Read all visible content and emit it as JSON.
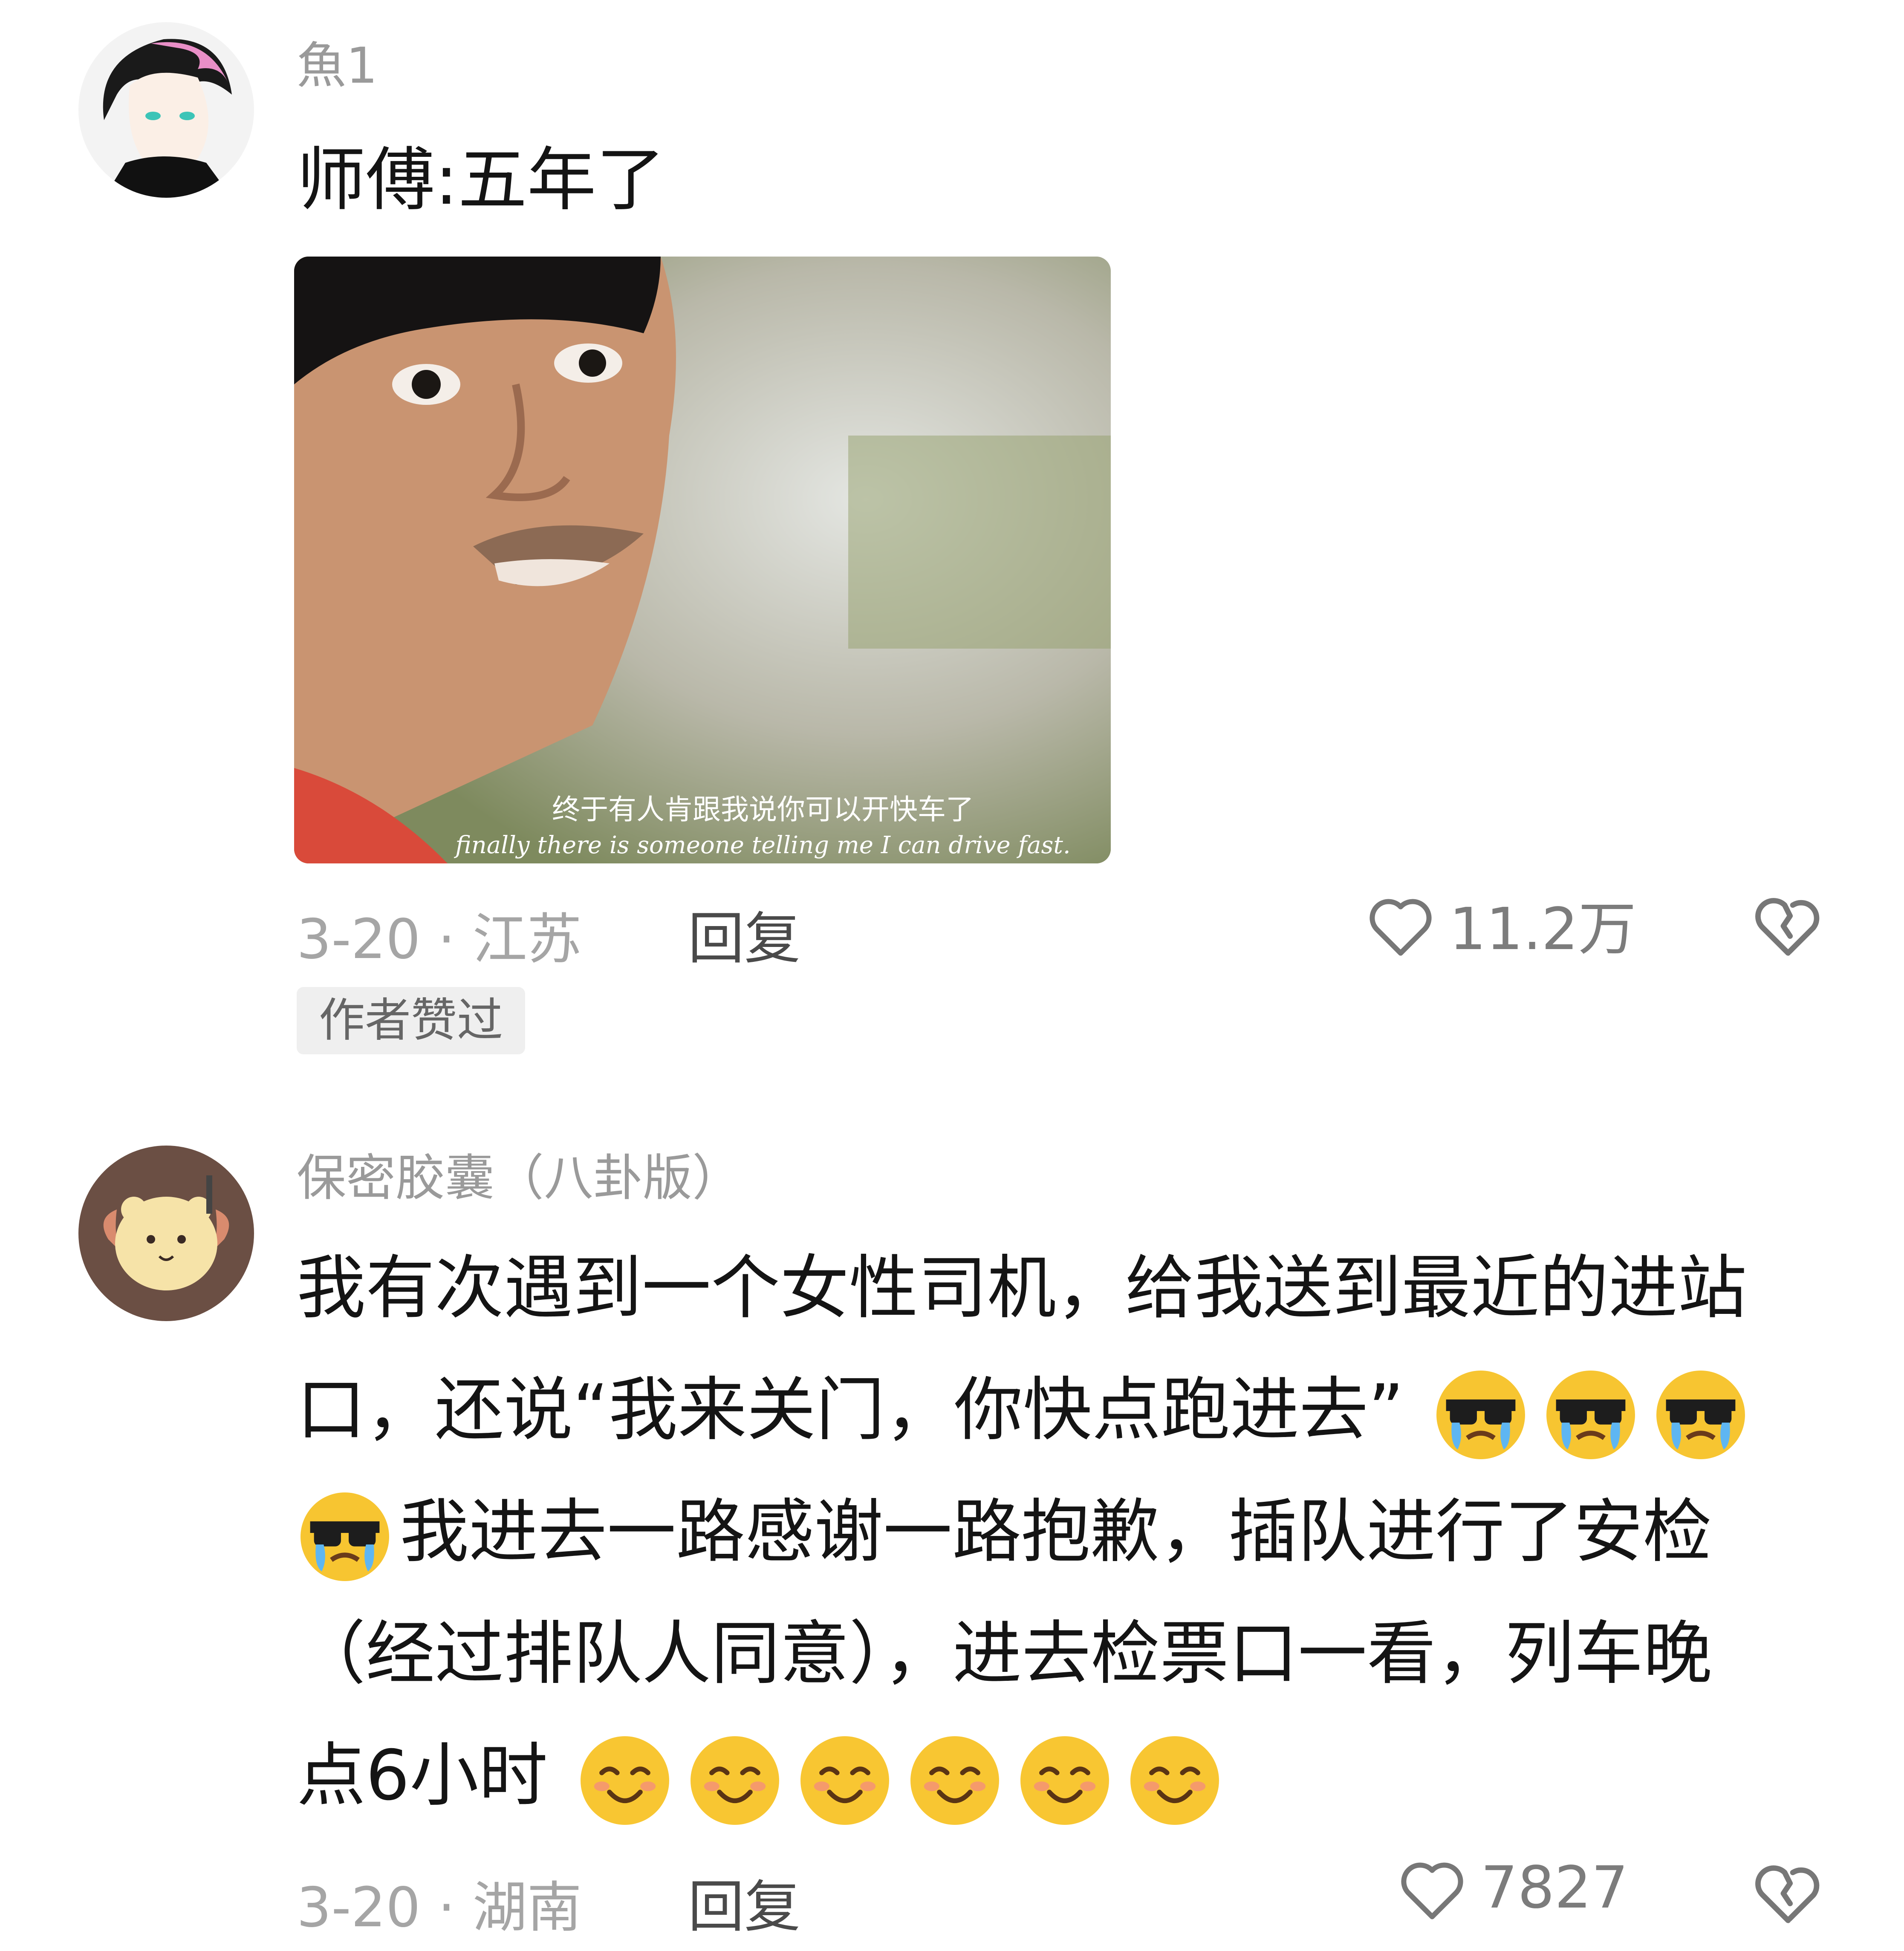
{
  "comments": [
    {
      "username": "魚1",
      "text": "师傅:五年了",
      "image": {
        "subtitle_cn": "终于有人肯跟我说你可以开快车了",
        "subtitle_en": "finally there is someone telling me I can drive fast."
      },
      "date_location": "3-20 · 江苏",
      "reply_label": "回复",
      "like_count": "11.2万",
      "badge": "作者赞过"
    },
    {
      "username": "保密胶囊（八卦版）",
      "text_lines": [
        "我有次遇到一个女性司机，给我送到最近的进站",
        "口，还说“我来关门，你快点跑进去”",
        "我进去一路感谢一路抱歉，插队进行了安检",
        "（经过排队人同意），进去检票口一看，列车晚",
        "点6小时"
      ],
      "emoji": {
        "line2": [
          "sunglasses-crying",
          "sunglasses-crying",
          "sunglasses-crying"
        ],
        "line3_prefix": [
          "sunglasses-crying"
        ],
        "line5": [
          "smile",
          "smile",
          "smile",
          "smile",
          "smile",
          "smile"
        ]
      },
      "date_location": "3-20 · 湖南",
      "reply_label": "回复",
      "like_count": "7827"
    }
  ],
  "colors": {
    "meta_gray": "#a5a5a5",
    "text": "#141414",
    "badge_bg": "#efefef"
  },
  "icons": [
    "heart-outline-icon",
    "broken-heart-icon"
  ]
}
